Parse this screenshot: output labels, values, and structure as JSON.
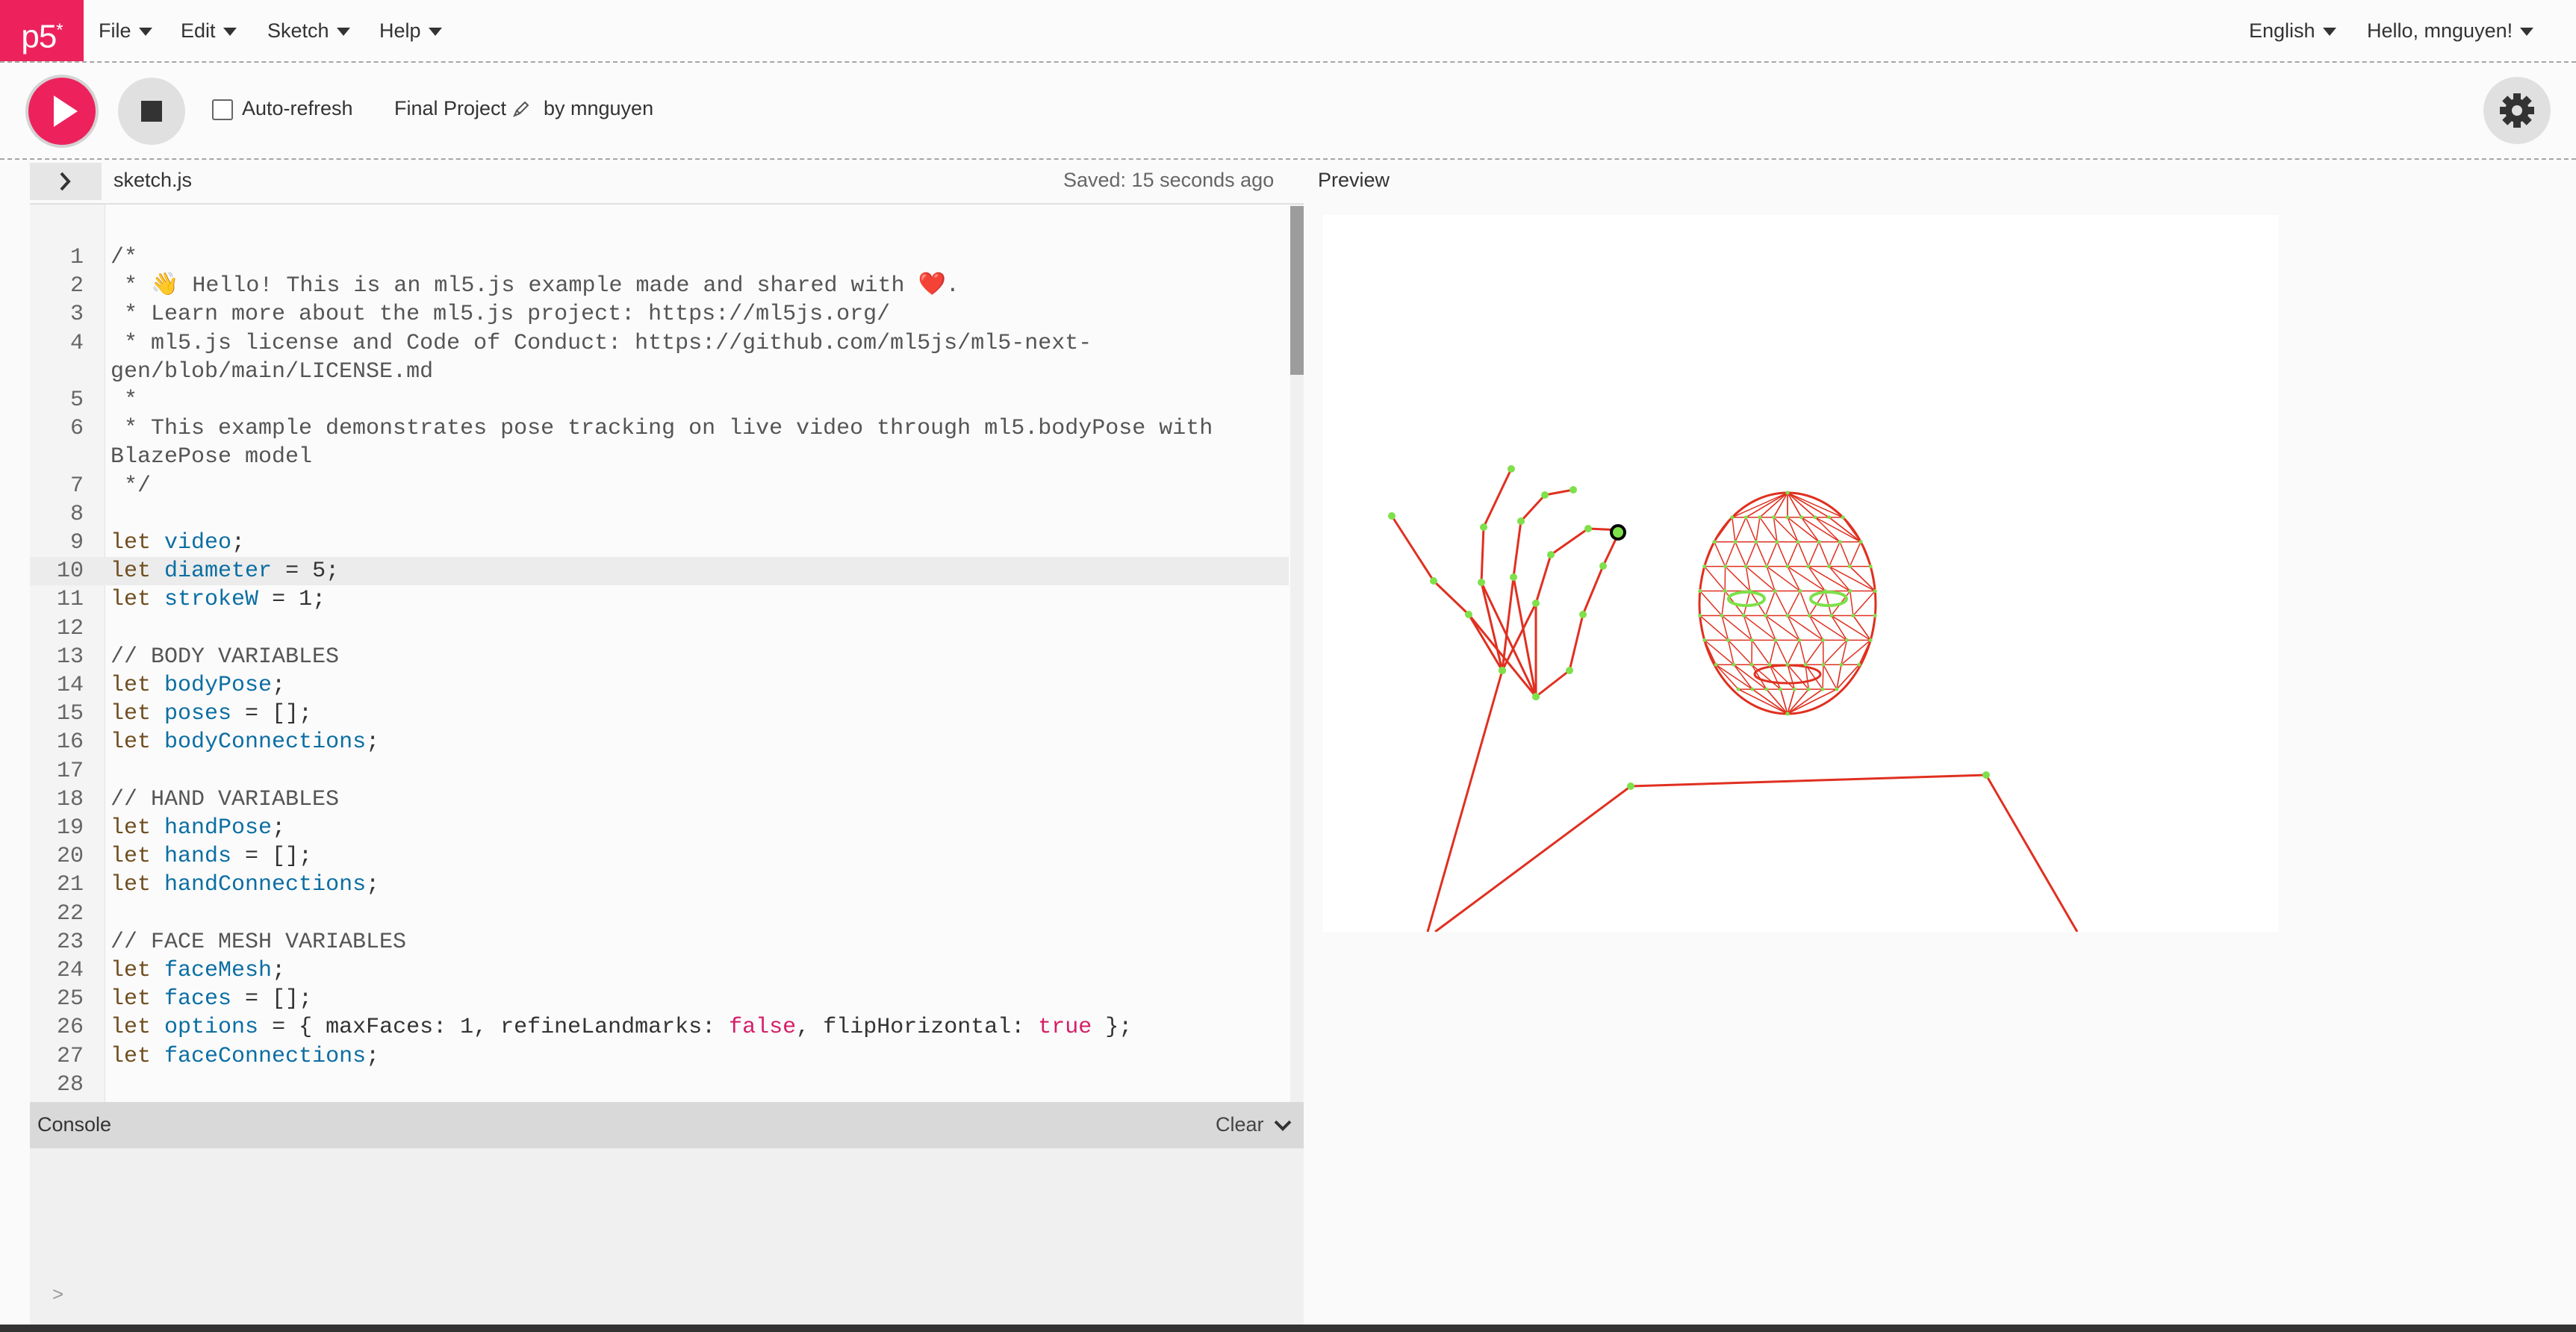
{
  "nav": {
    "logo": "p5*",
    "menus": [
      "File",
      "Edit",
      "Sketch",
      "Help"
    ],
    "language": "English",
    "user": "Hello, mnguyen!"
  },
  "toolbar": {
    "auto_refresh_label": "Auto-refresh",
    "project_name": "Final Project",
    "by_label": "by mnguyen"
  },
  "editor": {
    "filename": "sketch.js",
    "saved_status": "Saved: 15 seconds ago",
    "preview_label": "Preview",
    "lines": [
      {
        "n": "1",
        "text": "/*"
      },
      {
        "n": "2",
        "text": " * 👋 Hello! This is an ml5.js example made and shared with ❤️."
      },
      {
        "n": "3",
        "text": " * Learn more about the ml5.js project: https://ml5js.org/"
      },
      {
        "n": "4",
        "text": " * ml5.js license and Code of Conduct: https://github.com/ml5js/ml5-next-"
      },
      {
        "n": "",
        "text": "gen/blob/main/LICENSE.md"
      },
      {
        "n": "5",
        "text": " *"
      },
      {
        "n": "6",
        "text": " * This example demonstrates pose tracking on live video through ml5.bodyPose with"
      },
      {
        "n": "",
        "text": "BlazePose model"
      },
      {
        "n": "7",
        "text": " */"
      },
      {
        "n": "8",
        "text": ""
      },
      {
        "n": "9",
        "text": "let video;"
      },
      {
        "n": "10",
        "text": "let diameter = 5;"
      },
      {
        "n": "11",
        "text": "let strokeW = 1;"
      },
      {
        "n": "12",
        "text": ""
      },
      {
        "n": "13",
        "text": "// BODY VARIABLES"
      },
      {
        "n": "14",
        "text": "let bodyPose;"
      },
      {
        "n": "15",
        "text": "let poses = [];"
      },
      {
        "n": "16",
        "text": "let bodyConnections;"
      },
      {
        "n": "17",
        "text": ""
      },
      {
        "n": "18",
        "text": "// HAND VARIABLES"
      },
      {
        "n": "19",
        "text": "let handPose;"
      },
      {
        "n": "20",
        "text": "let hands = [];"
      },
      {
        "n": "21",
        "text": "let handConnections;"
      },
      {
        "n": "22",
        "text": ""
      },
      {
        "n": "23",
        "text": "// FACE MESH VARIABLES"
      },
      {
        "n": "24",
        "text": "let faceMesh;"
      },
      {
        "n": "25",
        "text": "let faces = [];"
      },
      {
        "n": "26",
        "text": "let options = { maxFaces: 1, refineLandmarks: false, flipHorizontal: true };"
      },
      {
        "n": "27",
        "text": "let faceConnections;"
      },
      {
        "n": "28",
        "text": ""
      }
    ]
  },
  "console": {
    "title": "Console",
    "clear_label": "Clear",
    "prompt": ">"
  },
  "colors": {
    "accent": "#ed225d",
    "skeleton_line": "#e03020",
    "keypoint": "#7ee04a"
  },
  "icons": {
    "play": "play-icon",
    "stop": "stop-icon",
    "settings": "gear-icon",
    "edit": "pencil-icon",
    "sidebar": "chevron-right-icon",
    "console_collapse": "chevron-down-icon"
  }
}
